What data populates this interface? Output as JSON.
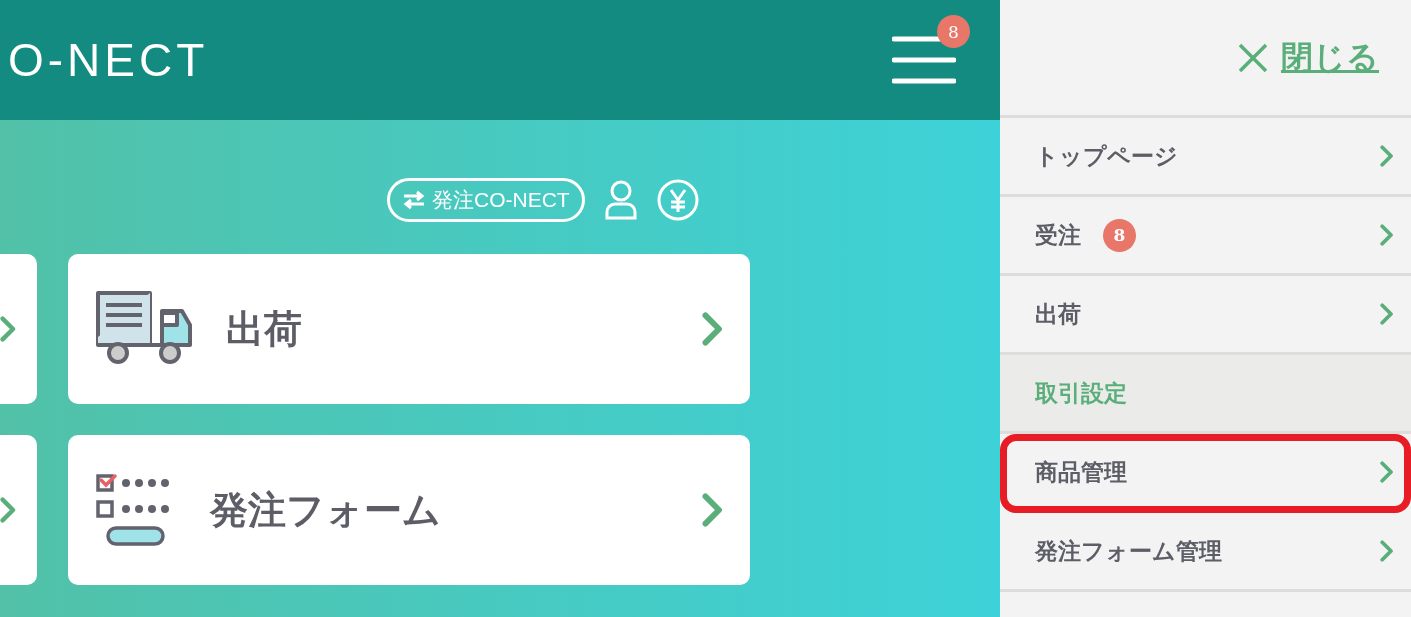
{
  "header": {
    "logo": "O-NECT",
    "menu_badge": "8"
  },
  "toolbar": {
    "switch_label": "発注CO-NECT"
  },
  "cards": [
    {
      "label": "出荷",
      "kind": "shipping"
    },
    {
      "label": "発注フォーム",
      "kind": "order-form"
    }
  ],
  "sidebar": {
    "close_label": "閉じる",
    "items": [
      {
        "kind": "link",
        "label": "トップページ",
        "highlighted": false
      },
      {
        "kind": "link",
        "label": "受注",
        "badge": "8",
        "highlighted": false
      },
      {
        "kind": "link",
        "label": "出荷",
        "highlighted": false
      },
      {
        "kind": "section",
        "label": "取引設定"
      },
      {
        "kind": "link",
        "label": "商品管理",
        "highlighted": true
      },
      {
        "kind": "link",
        "label": "発注フォーム管理",
        "highlighted": false
      }
    ]
  }
}
